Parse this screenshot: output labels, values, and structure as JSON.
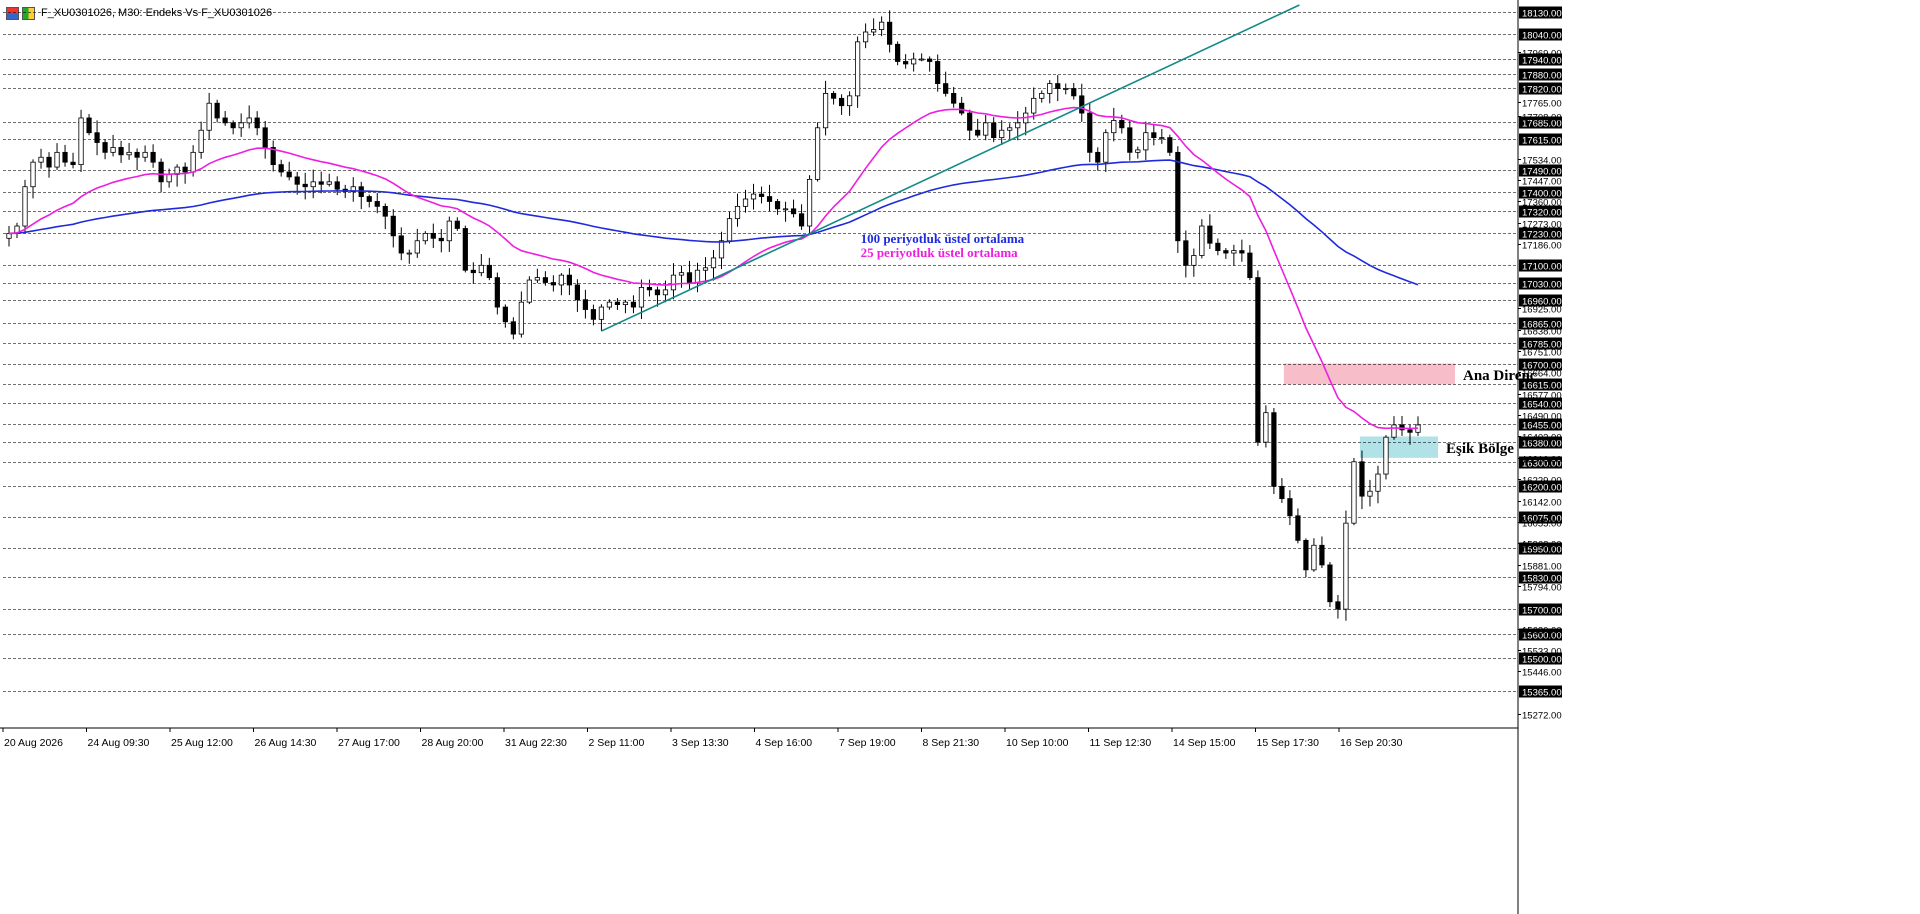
{
  "window": {
    "symbol": "F_XU0301026",
    "timeframe": "M30",
    "description": "Endeks Vs F_XU0301026",
    "title_text": "F_XU0301026, M30:  Endeks Vs F_XU0301026"
  },
  "colors": {
    "background": "#ffffff",
    "grid": "#000000",
    "candle": "#000000",
    "ema100": "#1f2bdb",
    "ema25": "#ee1fe0",
    "trendline": "#138a86",
    "resistance_zone": "#f6b6c3",
    "threshold_zone": "#a9dfe6",
    "price_label_bg": "#000000",
    "price_label_text": "#ffffff"
  },
  "icons": [
    "chart-window-icon",
    "chart-properties-icon"
  ],
  "chart_data": {
    "type": "candlestick",
    "timeframe": "M30",
    "ylim": [
      15220,
      18160
    ],
    "grid": "horizontal-dashed",
    "x_tick_labels": [
      "20 Aug 2026",
      "24 Aug 09:30",
      "25 Aug 12:00",
      "26 Aug 14:30",
      "27 Aug 17:00",
      "28 Aug 20:00",
      "31 Aug 22:30",
      "2 Sep 11:00",
      "3 Sep 13:30",
      "4 Sep 16:00",
      "7 Sep 19:00",
      "8 Sep 21:30",
      "10 Sep 10:00",
      "11 Sep 12:30",
      "14 Sep 15:00",
      "15 Sep 17:30",
      "16 Sep 20:30"
    ],
    "y_levels_highlighted": [
      "18130.00",
      "18040.00",
      "17940.00",
      "17880.00",
      "17820.00",
      "17685.00",
      "17615.00",
      "17490.00",
      "17400.00",
      "17320.00",
      "17230.00",
      "17100.00",
      "17030.00",
      "16960.00",
      "16865.00",
      "16785.00",
      "16700.00",
      "16615.00",
      "16540.00",
      "16455.00",
      "16380.00",
      "16300.00",
      "16200.00",
      "16075.00",
      "15950.00",
      "15830.00",
      "15700.00",
      "15600.00",
      "15500.00",
      "15365.00"
    ],
    "y_levels_plain": [
      "17969.00",
      "17765.00",
      "17708.00",
      "17534.00",
      "17447.00",
      "17360.00",
      "17273.00",
      "17186.00",
      "16925.00",
      "16838.00",
      "16751.00",
      "16664.00",
      "16577.00",
      "16490.00",
      "16403.00",
      "16316.00",
      "16229.00",
      "16142.00",
      "16055.00",
      "15968.00",
      "15881.00",
      "15794.00",
      "15620.00",
      "15533.00",
      "15446.00",
      "15272.00"
    ],
    "series_close": [
      17230,
      17260,
      17420,
      17520,
      17540,
      17500,
      17560,
      17520,
      17510,
      17700,
      17640,
      17600,
      17560,
      17580,
      17550,
      17560,
      17540,
      17560,
      17520,
      17440,
      17470,
      17500,
      17480,
      17560,
      17650,
      17760,
      17700,
      17680,
      17660,
      17680,
      17700,
      17660,
      17580,
      17510,
      17480,
      17460,
      17430,
      17420,
      17440,
      17430,
      17440,
      17410,
      17400,
      17420,
      17380,
      17360,
      17340,
      17300,
      17220,
      17150,
      17150,
      17200,
      17230,
      17210,
      17200,
      17280,
      17250,
      17080,
      17070,
      17100,
      17050,
      16930,
      16870,
      16820,
      16950,
      17040,
      17050,
      17030,
      17020,
      17060,
      17020,
      16960,
      16920,
      16880,
      16930,
      16950,
      16940,
      16950,
      16930,
      17010,
      17000,
      16980,
      17000,
      17060,
      17070,
      17030,
      17080,
      17090,
      17130,
      17200,
      17290,
      17340,
      17370,
      17390,
      17380,
      17360,
      17330,
      17330,
      17310,
      17260,
      17450,
      17660,
      17800,
      17780,
      17750,
      17790,
      18010,
      18050,
      18060,
      18090,
      18000,
      17930,
      17920,
      17940,
      17940,
      17930,
      17840,
      17800,
      17760,
      17720,
      17650,
      17630,
      17680,
      17620,
      17650,
      17660,
      17680,
      17720,
      17780,
      17800,
      17840,
      17820,
      17820,
      17790,
      17720,
      17560,
      17520,
      17640,
      17690,
      17660,
      17560,
      17570,
      17640,
      17620,
      17620,
      17560,
      17200,
      17100,
      17140,
      17260,
      17190,
      17160,
      17150,
      17160,
      17150,
      17050,
      16380,
      16500,
      16200,
      16150,
      16080,
      15980,
      15860,
      15960,
      15880,
      15730,
      15700,
      16050,
      16300,
      16160,
      16180,
      16250,
      16400,
      16450,
      16430,
      16420,
      16450
    ],
    "series": [
      {
        "name": "100 periyotluk üstel ortalama",
        "type": "ema",
        "period": 100,
        "color": "#1f2bdb"
      },
      {
        "name": "25 periyotluk üstel ortalama",
        "type": "ema",
        "period": 25,
        "color": "#ee1fe0"
      }
    ],
    "zones": [
      {
        "label": "Ana Direnç",
        "from": 16615,
        "to": 16700,
        "color": "#f6b6c3"
      },
      {
        "label": "Eşik Bölge",
        "from": 16316,
        "to": 16403,
        "color": "#a9dfe6"
      }
    ],
    "trendline": {
      "color": "#138a86"
    },
    "annotations": [
      {
        "text": "100 periyotluk üstel ortalama",
        "color": "#1f2bdb"
      },
      {
        "text": "25 periyotluk üstel ortalama",
        "color": "#ee1fe0"
      },
      {
        "text": "Ana Direnç",
        "color": "#000000"
      },
      {
        "text": "Eşik Bölge",
        "color": "#000000"
      }
    ]
  }
}
